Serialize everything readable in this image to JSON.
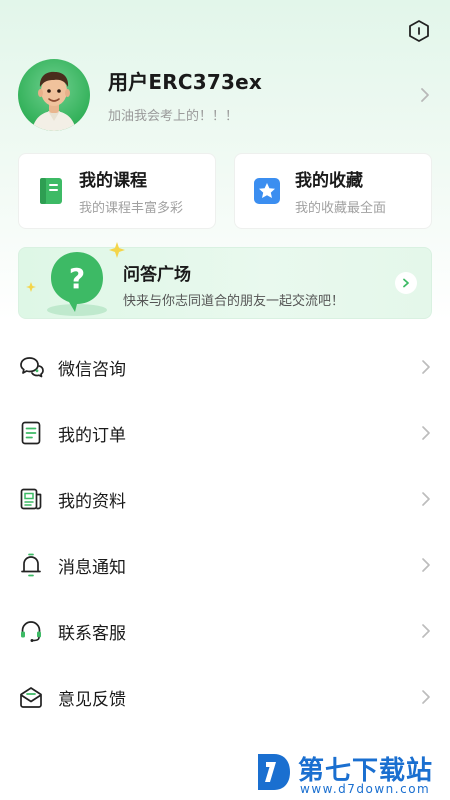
{
  "profile": {
    "username": "用户ERC373ex",
    "motto": "加油我会考上的！！！"
  },
  "cards": [
    {
      "title": "我的课程",
      "subtitle": "我的课程丰富多彩",
      "icon": "book-icon",
      "color": "#3dba65"
    },
    {
      "title": "我的收藏",
      "subtitle": "我的收藏最全面",
      "icon": "star-icon",
      "color": "#3b8ef0"
    }
  ],
  "qa": {
    "title": "问答广场",
    "subtitle": "快来与你志同道合的朋友一起交流吧！",
    "icon": "question-bubble-icon"
  },
  "menu": [
    {
      "label": "微信咨询",
      "icon": "chat-bubbles-icon"
    },
    {
      "label": "我的订单",
      "icon": "order-document-icon"
    },
    {
      "label": "我的资料",
      "icon": "newspaper-icon"
    },
    {
      "label": "消息通知",
      "icon": "bell-icon"
    },
    {
      "label": "联系客服",
      "icon": "headset-icon"
    },
    {
      "label": "意见反馈",
      "icon": "envelope-icon"
    }
  ],
  "watermark": {
    "brand": "第七下载站",
    "url": "www.d7down.com"
  },
  "colors": {
    "accent": "#3dba65",
    "blue": "#3b8ef0",
    "text": "#1a1a1a",
    "muted": "#9a9a9a"
  }
}
